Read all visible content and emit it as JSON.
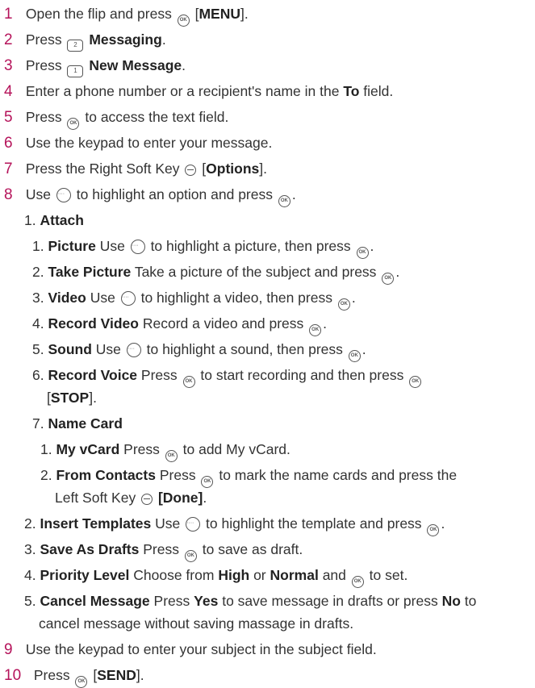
{
  "step1": {
    "num": "1",
    "a": "Open the flip and press",
    "b": "[",
    "menu": "MENU",
    "c": "]."
  },
  "step2": {
    "num": "2",
    "a": "Press",
    "key": "2",
    "msg": "Messaging",
    "c": "."
  },
  "step3": {
    "num": "3",
    "a": "Press",
    "key": "1",
    "msg": "New Message",
    "c": "."
  },
  "step4": {
    "num": "4",
    "a": "Enter a phone number or a recipient's name in the",
    "to": "To",
    "c": "field."
  },
  "step5": {
    "num": "5",
    "a": "Press",
    "c": "to access the text field."
  },
  "step6": {
    "num": "6",
    "a": "Use the keypad to enter your message."
  },
  "step7": {
    "num": "7",
    "a": "Press the Right Soft Key",
    "b": "[",
    "opt": "Options",
    "c": "]."
  },
  "step8": {
    "num": "8",
    "a": "Use",
    "c": "to highlight an option and press",
    "d": "."
  },
  "attach": {
    "num": "1.",
    "label": "Attach"
  },
  "a1": {
    "num": "1.",
    "t": "Picture",
    "a": "Use",
    "c": "to highlight a picture, then press",
    "d": "."
  },
  "a2": {
    "num": "2.",
    "t": "Take Picture",
    "a": "Take a picture of the subject and press",
    "d": "."
  },
  "a3": {
    "num": "3.",
    "t": "Video",
    "a": "Use",
    "c": "to highlight a video, then press",
    "d": "."
  },
  "a4": {
    "num": "4.",
    "t": "Record Video",
    "a": "Record a video and press",
    "d": "."
  },
  "a5": {
    "num": "5.",
    "t": "Sound",
    "a": "Use",
    "c": "to highlight a sound, then press",
    "d": "."
  },
  "a6": {
    "num": "6.",
    "t": "Record Voice",
    "a": "Press",
    "c": "to start recording and then press",
    "b": "[",
    "stop": "STOP",
    "d": "]."
  },
  "a7": {
    "num": "7.",
    "t": "Name Card"
  },
  "n1": {
    "num": "1.",
    "t": "My vCard",
    "a": "Press",
    "c": "to add My vCard."
  },
  "n2": {
    "num": "2.",
    "t": "From Contacts",
    "a": "Press",
    "c": "to mark the name cards and press the",
    "l2": "Left Soft Key",
    "done": "[Done]",
    "d": "."
  },
  "o2": {
    "num": "2.",
    "t": "Insert Templates",
    "a": "Use",
    "c": "to highlight the template and press",
    "d": "."
  },
  "o3": {
    "num": "3.",
    "t": "Save As Drafts",
    "a": "Press",
    "c": "to save as draft."
  },
  "o4": {
    "num": "4.",
    "t": "Priority Level",
    "a": "Choose from",
    "high": "High",
    "or": "or",
    "normal": "Normal",
    "c": "and",
    "d": "to set."
  },
  "o5": {
    "num": "5.",
    "t": "Cancel Message",
    "a": "Press",
    "yes": "Yes",
    "b": "to save message in drafts or press",
    "no": "No",
    "c": "to",
    "l2": "cancel message without saving massage in drafts."
  },
  "step9": {
    "num": "9",
    "a": "Use the keypad to enter your subject in the subject field."
  },
  "step10": {
    "num": "10",
    "a": "Press",
    "b": "[",
    "send": "SEND",
    "c": "]."
  },
  "icons": {
    "ok": "OK",
    "key2": "2",
    "key1": "1"
  }
}
